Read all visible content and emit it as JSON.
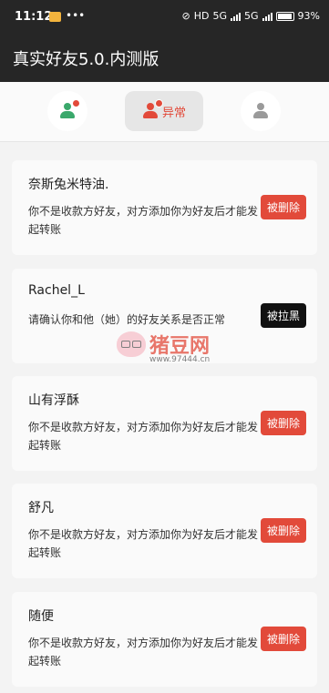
{
  "status_bar": {
    "time": "11:12",
    "dots": "•••",
    "hd": "HD",
    "sig1": "5G",
    "sig2": "5G",
    "battery": "93%"
  },
  "app_bar": {
    "title": "真实好友5.0.内测版"
  },
  "tabs": [
    {
      "icon": "user-check-icon",
      "label": ""
    },
    {
      "icon": "user-warning-icon",
      "label": "异常"
    },
    {
      "icon": "user-icon",
      "label": ""
    }
  ],
  "cards": [
    {
      "name": "奈斯兔米特油.",
      "message": "你不是收款方好友，对方添加你为好友后才能发起转账",
      "action": "被删除"
    },
    {
      "name": "Rachel_L",
      "message": "请确认你和他（她）的好友关系是否正常",
      "action": "被拉黑"
    },
    {
      "name": "山有浮酥",
      "message": "你不是收款方好友，对方添加你为好友后才能发起转账",
      "action": "被删除"
    },
    {
      "name": "舒凡",
      "message": "你不是收款方好友，对方添加你为好友后才能发起转账",
      "action": "被删除"
    },
    {
      "name": "随便",
      "message": "你不是收款方好友，对方添加你为好友后才能发起转账",
      "action": "被删除"
    }
  ],
  "watermark": {
    "text": "猪豆网",
    "url": "www.97444.cn"
  },
  "colors": {
    "accent": "#e24a3a",
    "dark": "#262626",
    "green": "#3aa86b"
  }
}
